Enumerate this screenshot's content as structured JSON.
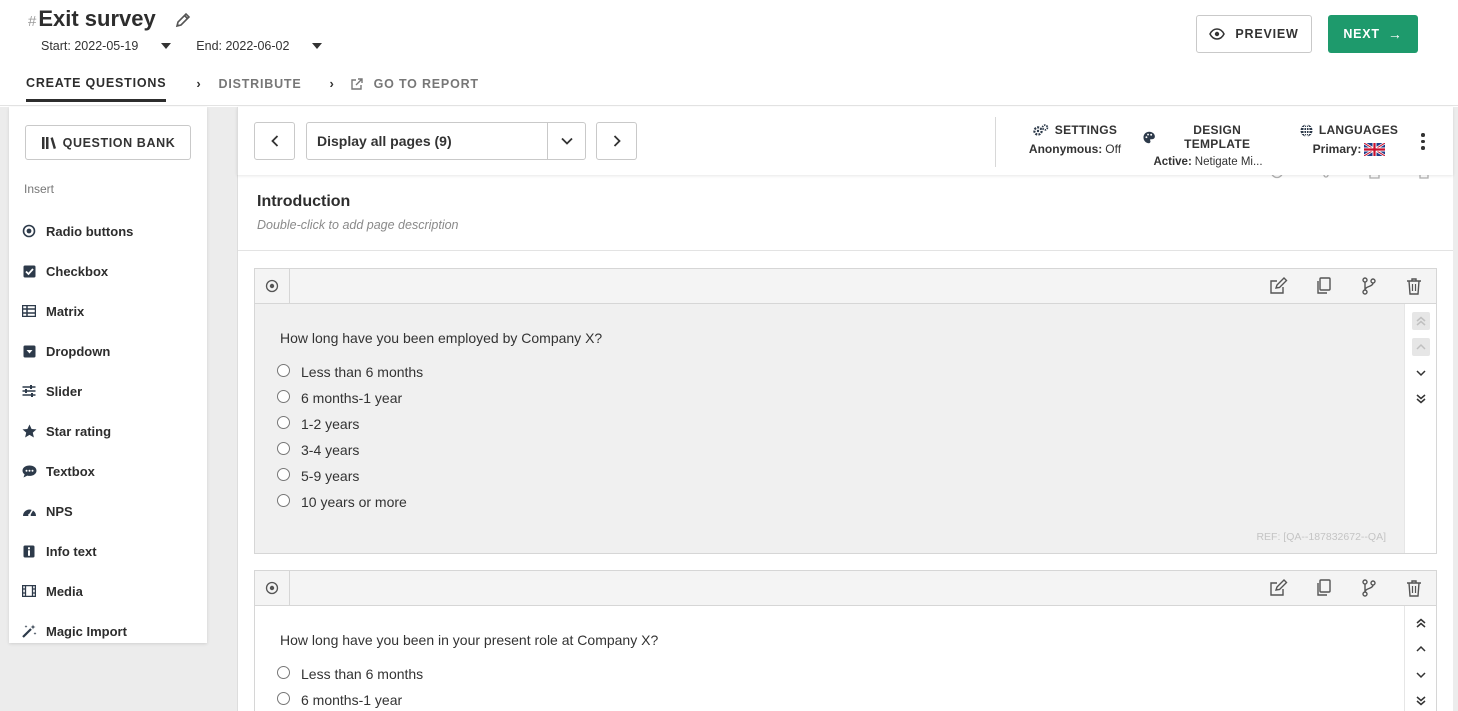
{
  "header": {
    "hash": "#",
    "title": "Exit survey",
    "start": "Start: 2022-05-19",
    "end": "End: 2022-06-02",
    "steps": [
      {
        "label": "CREATE QUESTIONS"
      },
      {
        "label": "DISTRIBUTE"
      },
      {
        "label": "GO TO REPORT"
      }
    ],
    "preview_label": "PREVIEW",
    "next_label": "NEXT",
    "next_arrow": "→",
    "accent_color": "#1e9a6c"
  },
  "sidebar": {
    "question_bank_label": "QUESTION BANK",
    "insert_label": "Insert",
    "items": [
      {
        "label": "Radio buttons",
        "icon": "radio-icon"
      },
      {
        "label": "Checkbox",
        "icon": "checkbox-icon"
      },
      {
        "label": "Matrix",
        "icon": "matrix-icon"
      },
      {
        "label": "Dropdown",
        "icon": "dropdown-icon"
      },
      {
        "label": "Slider",
        "icon": "slider-icon"
      },
      {
        "label": "Star rating",
        "icon": "star-icon"
      },
      {
        "label": "Textbox",
        "icon": "textbox-icon"
      },
      {
        "label": "NPS",
        "icon": "nps-gauge-icon"
      },
      {
        "label": "Info text",
        "icon": "info-icon"
      },
      {
        "label": "Media",
        "icon": "media-icon"
      },
      {
        "label": "Magic Import",
        "icon": "magic-wand-icon"
      }
    ]
  },
  "toolbar": {
    "page_select_value": "Display all pages (9)",
    "settings": {
      "title": "SETTINGS",
      "key": "Anonymous:",
      "value": "Off"
    },
    "design": {
      "title": "DESIGN TEMPLATE",
      "key": "Active:",
      "value": "Netigate Mi..."
    },
    "languages": {
      "title": "LANGUAGES",
      "key": "Primary:",
      "flag": "uk-flag-icon"
    }
  },
  "page": {
    "title": "Introduction",
    "description": "Double-click to add page description"
  },
  "questions": [
    {
      "text": "How long have you been employed by Company X?",
      "options": [
        "Less than 6 months",
        "6 months-1 year",
        "1-2 years",
        "3-4 years",
        "5-9 years",
        "10 years or more"
      ],
      "ref": "REF: [QA--187832672--QA]"
    },
    {
      "text": "How long have you been in your present role at Company X?",
      "options": [
        "Less than 6 months",
        "6 months-1 year"
      ]
    }
  ]
}
